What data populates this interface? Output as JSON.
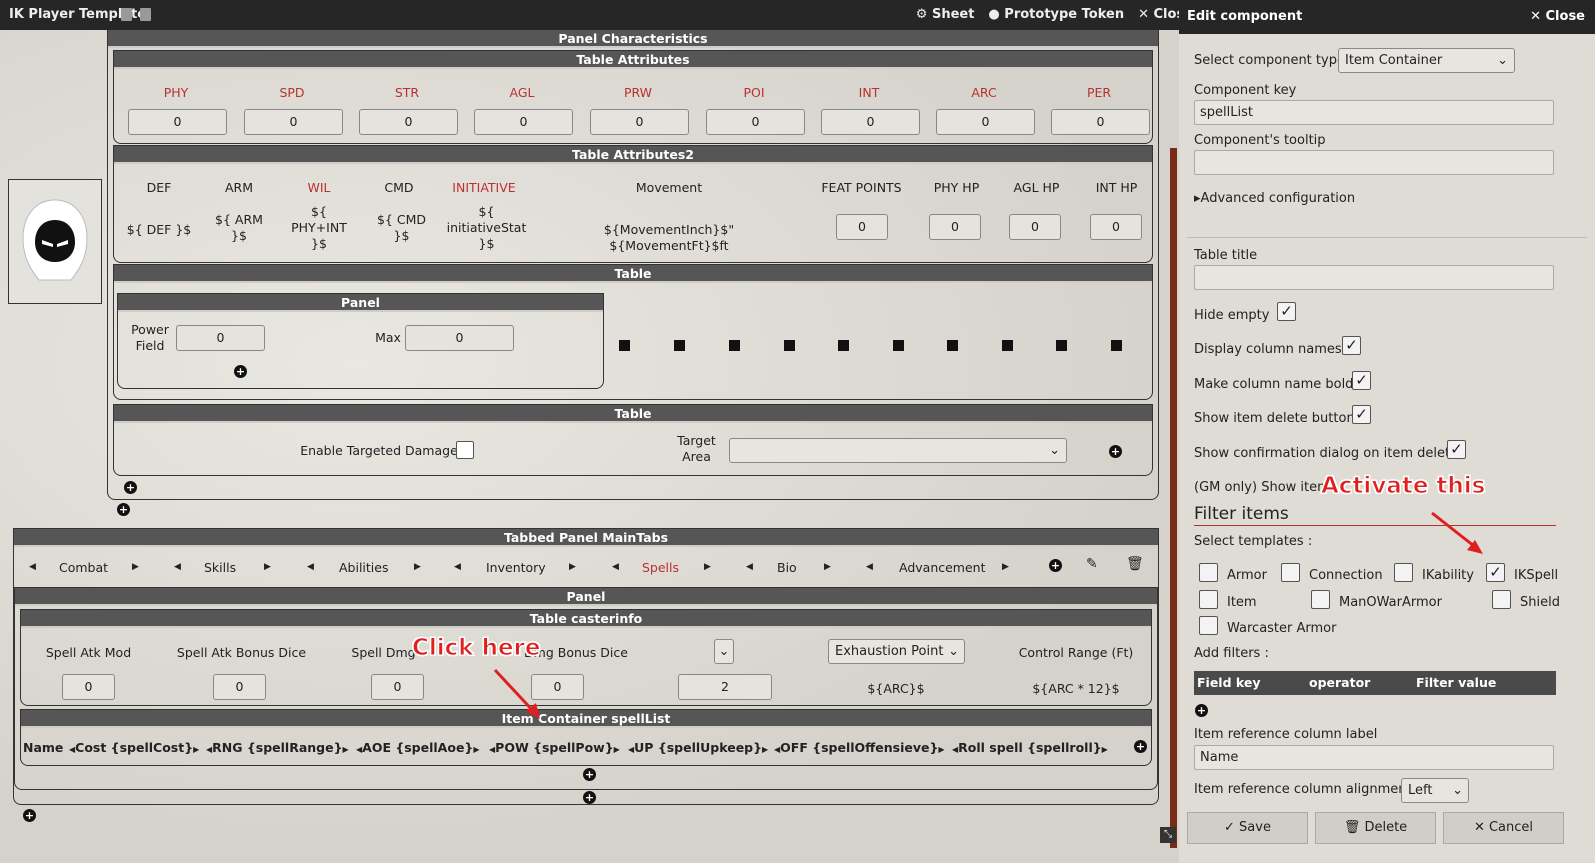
{
  "window": {
    "title": "IK Player Template",
    "sheet": "Sheet",
    "prototype": "Prototype Token",
    "close": "Close"
  },
  "panel_char": {
    "title": "Panel Characteristics"
  },
  "attributes": {
    "title": "Table Attributes",
    "items": [
      {
        "label": "PHY",
        "value": "0"
      },
      {
        "label": "SPD",
        "value": "0"
      },
      {
        "label": "STR",
        "value": "0"
      },
      {
        "label": "AGL",
        "value": "0"
      },
      {
        "label": "PRW",
        "value": "0"
      },
      {
        "label": "POI",
        "value": "0"
      },
      {
        "label": "INT",
        "value": "0"
      },
      {
        "label": "ARC",
        "value": "0"
      },
      {
        "label": "PER",
        "value": "0"
      }
    ]
  },
  "attributes2": {
    "title": "Table Attributes2",
    "def": "DEF",
    "arm": "ARM",
    "wil": "WIL",
    "cmd": "CMD",
    "initiative": "INITIATIVE",
    "movement": "Movement",
    "feat": "FEAT POINTS",
    "phyhp": "PHY HP",
    "aglhp": "AGL HP",
    "inthp": "INT HP",
    "def_v": "${ DEF }$",
    "arm_v1": "${ ARM",
    "arm_v2": "}$",
    "wil_v1": "${",
    "wil_v2": "PHY+INT",
    "wil_v3": "}$",
    "cmd_v1": "${ CMD",
    "cmd_v2": "}$",
    "ini_v1": "${",
    "ini_v2": "initiativeStat",
    "ini_v3": "}$",
    "move_v": "${MovementInch}$\" ${MovementFt}$ft",
    "feat_v": "0",
    "phyhp_v": "0",
    "aglhp_v": "0",
    "inthp_v": "0"
  },
  "table1": {
    "title": "Table",
    "panel": "Panel",
    "power1": "Power",
    "power2": "Field",
    "power_v": "0",
    "max": "Max",
    "max_v": "0"
  },
  "table2": {
    "title": "Table",
    "enable": "Enable Targeted Damage",
    "target1": "Target",
    "target2": "Area"
  },
  "tabbed": {
    "title": "Tabbed Panel MainTabs",
    "tabs": [
      "Combat",
      "Skills",
      "Abilities",
      "Inventory",
      "Spells",
      "Bio",
      "Advancement"
    ]
  },
  "panel2": {
    "title": "Panel"
  },
  "casterinfo": {
    "title": "Table casterinfo",
    "h1": "Spell Atk Mod",
    "h2": "Spell Atk Bonus Dice",
    "h3": "Spell Dmg",
    "h4": "Dmg Bonus Dice",
    "exhaust": "Exhaustion Point",
    "range": "Control Range (Ft)",
    "v1": "0",
    "v2": "0",
    "v3": "0",
    "v4": "0",
    "v5": "2",
    "v6": "${ARC}$",
    "v7": "${ARC * 12}$"
  },
  "spelllist": {
    "title": "Item Container spellList",
    "cols": [
      "Name",
      "Cost {spellCost}",
      "RNG {spellRange}",
      "AOE {spellAoe}",
      "POW {spellPow}",
      "UP {spellUpkeep}",
      "OFF {spellOffensieve}",
      "Roll spell {spellroll}"
    ]
  },
  "editor": {
    "title": "Edit component",
    "close": "Close",
    "type_label": "Select component type",
    "type_value": "Item Container",
    "key_label": "Component key",
    "key_value": "spellList",
    "tooltip_label": "Component's tooltip",
    "advanced": "Advanced configuration",
    "table_title": "Table title",
    "hide_empty": "Hide empty",
    "display_cols": "Display column names",
    "bold": "Make column name bold",
    "delete_btn": "Show item delete button",
    "confirm": "Show confirmation dialog on item delete",
    "gm": "(GM only) Show item",
    "filter": "Filter items",
    "select_tpl": "Select templates :",
    "templates": [
      "Armor",
      "Connection",
      "IKability",
      "IKSpell",
      "Item",
      "ManOWarArmor",
      "Shield",
      "Warcaster Armor"
    ],
    "add_filters": "Add filters :",
    "fk": "Field key",
    "op": "operator",
    "fv": "Filter value",
    "ref_label": "Item reference column label",
    "ref_value": "Name",
    "align_label": "Item reference column alignment",
    "align_value": "Left",
    "save": "Save",
    "delete": "Delete",
    "cancel": "Cancel"
  },
  "annotations": {
    "activate": "Activate this",
    "click": "Click here"
  }
}
